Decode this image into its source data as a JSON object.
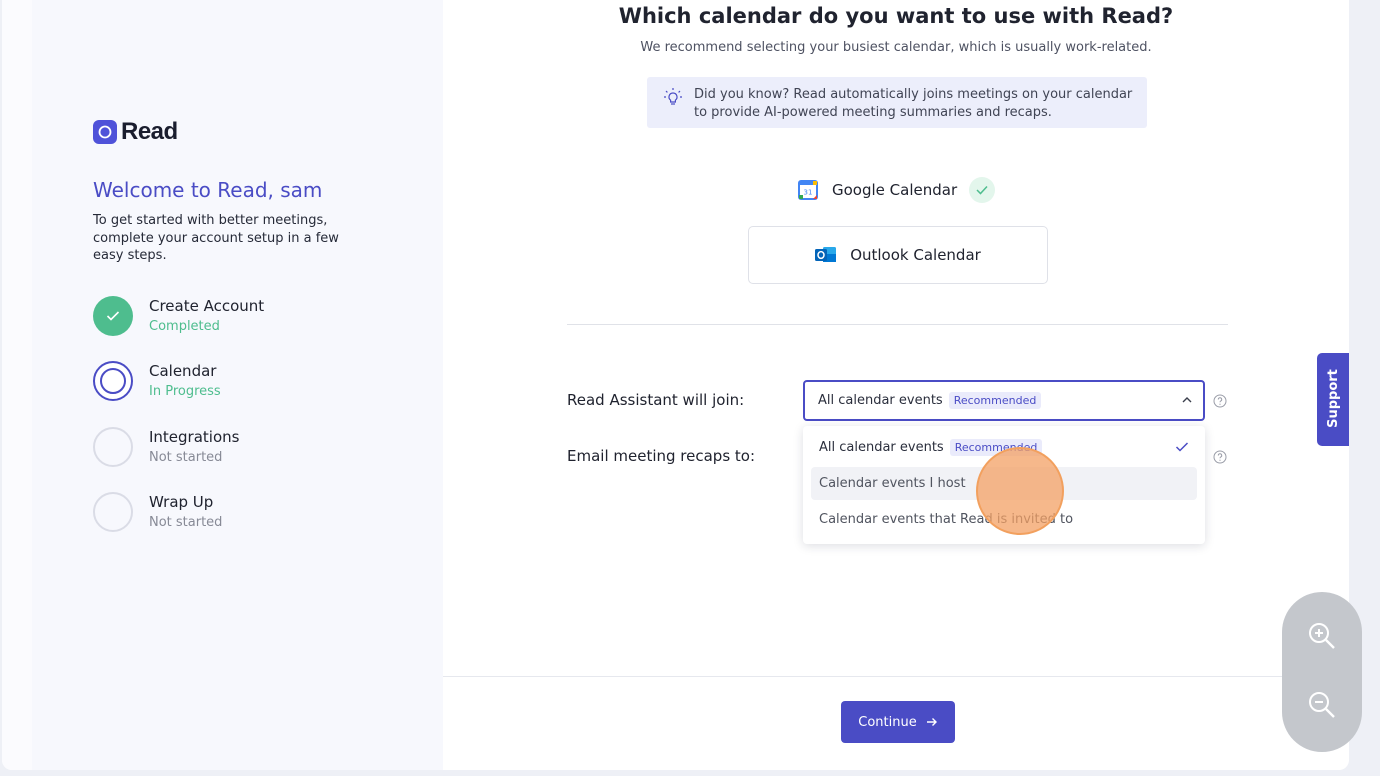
{
  "sidebar": {
    "logo_text": "Read",
    "welcome": "Welcome to Read, sam",
    "intro": "To get started with better meetings, complete your account setup in a few easy steps.",
    "steps": [
      {
        "title": "Create Account",
        "status": "Completed",
        "state": "done"
      },
      {
        "title": "Calendar",
        "status": "In Progress",
        "state": "current"
      },
      {
        "title": "Integrations",
        "status": "Not started",
        "state": "todo"
      },
      {
        "title": "Wrap Up",
        "status": "Not started",
        "state": "todo"
      }
    ]
  },
  "main": {
    "title": "Which calendar do you want to use with Read?",
    "subtitle": "We recommend selecting your busiest calendar, which is usually work-related.",
    "tip": "Did you know? Read automatically joins meetings on your calendar to provide AI-powered meeting summaries and recaps.",
    "google_calendar": "Google Calendar",
    "outlook_calendar": "Outlook Calendar",
    "join_label": "Read Assistant will join:",
    "recap_label": "Email meeting recaps to:",
    "select_value": "All calendar events",
    "recommended_badge": "Recommended",
    "options": [
      {
        "label": "All calendar events",
        "badge": "Recommended",
        "selected": true
      },
      {
        "label": "Calendar events I host",
        "selected": false
      },
      {
        "label": "Calendar events that Read is invited to",
        "selected": false
      }
    ],
    "continue": "Continue"
  },
  "support": "Support",
  "colors": {
    "accent": "#4a4cc5",
    "success": "#4ebd8e"
  }
}
